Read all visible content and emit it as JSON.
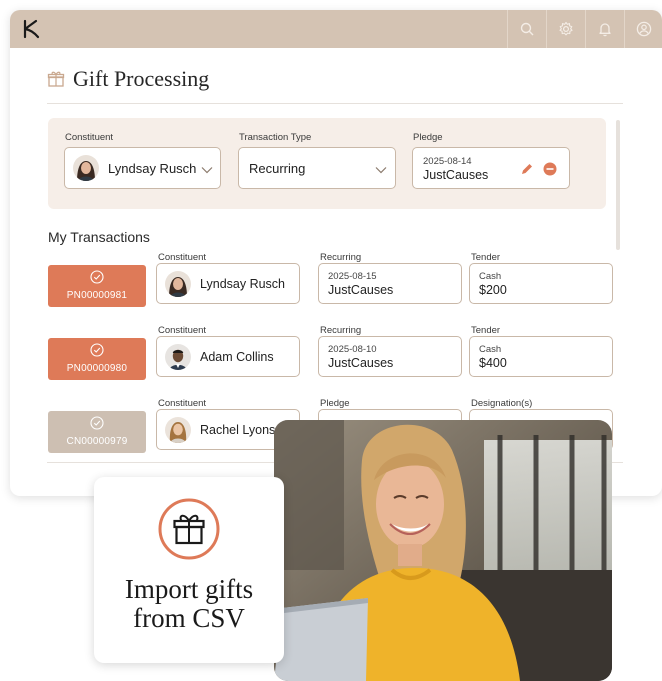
{
  "app": {
    "logo": "K",
    "colors": {
      "topbar": "#d4c3b3",
      "accent": "#de7a58",
      "accent_muted": "#cdbfb2",
      "panel": "#f6eee8"
    },
    "topbar_icons": [
      "search-icon",
      "gear-icon",
      "bell-icon",
      "user-avatar-icon"
    ]
  },
  "page": {
    "title": "Gift Processing",
    "title_icon": "gift-icon"
  },
  "filters": {
    "constituent": {
      "label": "Constituent",
      "value": "Lyndsay Rusch"
    },
    "transaction_type": {
      "label": "Transaction Type",
      "value": "Recurring"
    },
    "pledge": {
      "label": "Pledge",
      "date": "2025-08-14",
      "name": "JustCauses"
    }
  },
  "transactions": {
    "title": "My Transactions",
    "rows": [
      {
        "id": "PN00000981",
        "status_color": "#de7a58",
        "constituent_label": "Constituent",
        "constituent": "Lyndsay Rusch",
        "type_label": "Recurring",
        "type_date": "2025-08-15",
        "type_name": "JustCauses",
        "tender_label": "Tender",
        "tender_method": "Cash",
        "tender_amount": "$200"
      },
      {
        "id": "PN00000980",
        "status_color": "#de7a58",
        "constituent_label": "Constituent",
        "constituent": "Adam Collins",
        "type_label": "Recurring",
        "type_date": "2025-08-10",
        "type_name": "JustCauses",
        "tender_label": "Tender",
        "tender_method": "Cash",
        "tender_amount": "$400"
      },
      {
        "id": "CN00000979",
        "status_color": "#cdbfb2",
        "constituent_label": "Constituent",
        "constituent": "Rachel Lyons",
        "type_label": "Pledge",
        "type_date": "",
        "type_name": "",
        "tender_label": "Designation(s)",
        "tender_method": "",
        "tender_amount": ""
      }
    ]
  },
  "import_card": {
    "line1": "Import gifts",
    "line2": "from CSV",
    "icon": "gift-icon"
  }
}
